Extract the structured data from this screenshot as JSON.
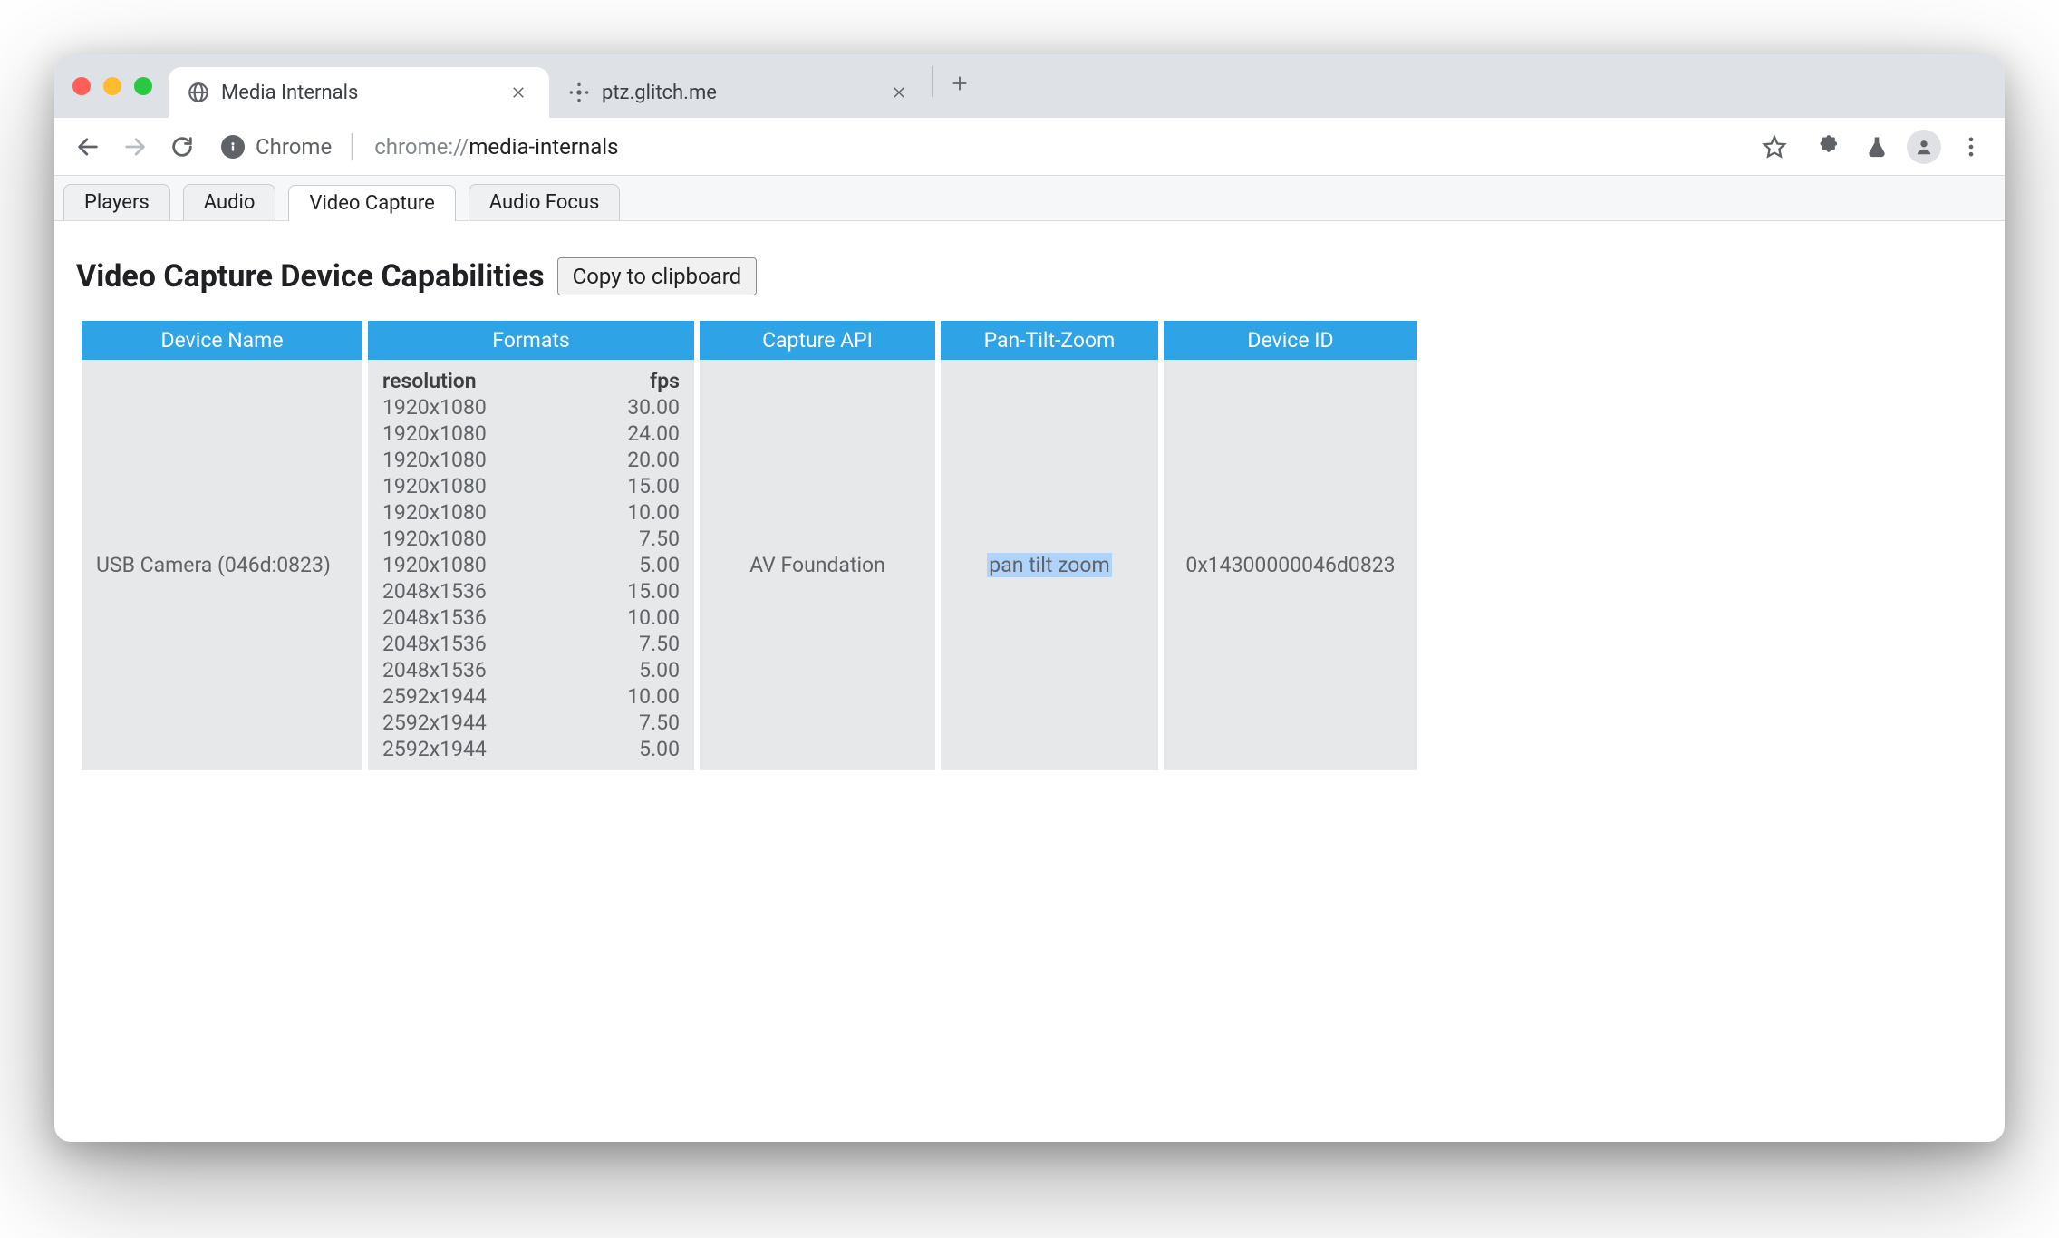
{
  "browser": {
    "tabs": [
      {
        "title": "Media Internals",
        "favicon": "globe",
        "active": true
      },
      {
        "title": "ptz.glitch.me",
        "favicon": "grid",
        "active": false
      }
    ],
    "omnibox": {
      "origin": "Chrome",
      "path_prefix": "chrome://",
      "path_suffix": "media-internals"
    }
  },
  "page": {
    "nav_tabs": [
      "Players",
      "Audio",
      "Video Capture",
      "Audio Focus"
    ],
    "nav_active_index": 2,
    "heading": "Video Capture Device Capabilities",
    "copy_label": "Copy to clipboard",
    "columns": [
      "Device Name",
      "Formats",
      "Capture API",
      "Pan-Tilt-Zoom",
      "Device ID"
    ],
    "device": {
      "name": "USB Camera (046d:0823)",
      "capture_api": "AV Foundation",
      "ptz": "pan tilt zoom",
      "device_id": "0x14300000046d0823",
      "format_headers": {
        "res": "resolution",
        "fps": "fps"
      },
      "formats": [
        {
          "res": "1920x1080",
          "fps": "30.00"
        },
        {
          "res": "1920x1080",
          "fps": "24.00"
        },
        {
          "res": "1920x1080",
          "fps": "20.00"
        },
        {
          "res": "1920x1080",
          "fps": "15.00"
        },
        {
          "res": "1920x1080",
          "fps": "10.00"
        },
        {
          "res": "1920x1080",
          "fps": "7.50"
        },
        {
          "res": "1920x1080",
          "fps": "5.00"
        },
        {
          "res": "2048x1536",
          "fps": "15.00"
        },
        {
          "res": "2048x1536",
          "fps": "10.00"
        },
        {
          "res": "2048x1536",
          "fps": "7.50"
        },
        {
          "res": "2048x1536",
          "fps": "5.00"
        },
        {
          "res": "2592x1944",
          "fps": "10.00"
        },
        {
          "res": "2592x1944",
          "fps": "7.50"
        },
        {
          "res": "2592x1944",
          "fps": "5.00"
        }
      ]
    }
  }
}
